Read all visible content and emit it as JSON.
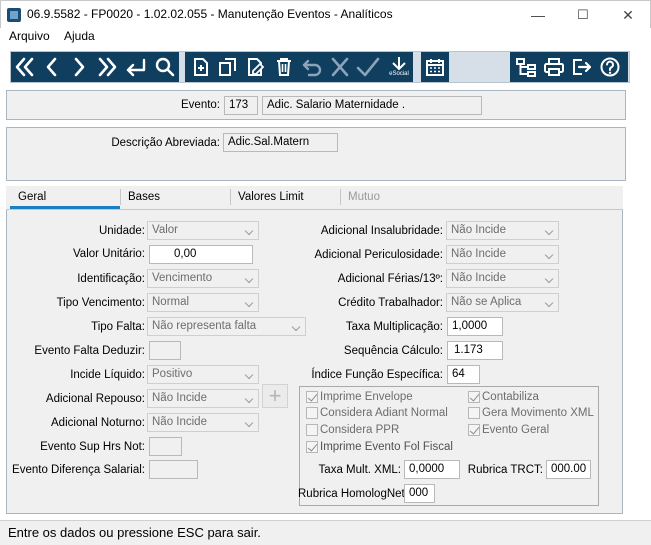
{
  "window": {
    "title": "06.9.5582 - FP0020 - 1.02.02.055 - Manutenção Eventos - Analíticos",
    "minimize": "—",
    "maximize": "☐",
    "close": "✕"
  },
  "menu": {
    "items": [
      "Arquivo",
      "Ajuda"
    ]
  },
  "toolbar": {
    "buttons": [
      "first-icon",
      "previous-icon",
      "next-icon",
      "last-icon",
      "enter-icon",
      "search-icon",
      "new-document-icon",
      "copy-icon",
      "edit-icon",
      "delete-icon",
      "undo-icon",
      "cancel-icon",
      "confirm-icon",
      "esocial-icon",
      "calendar-icon",
      "hierarchy-icon",
      "print-icon",
      "exit-icon",
      "help-icon"
    ],
    "esocial_label": "eSocial"
  },
  "header": {
    "evento_label": "Evento:",
    "evento_code": "173",
    "evento_name": "Adic. Salario Maternidade  .",
    "descricao_label": "Descrição Abreviada:",
    "descricao_value": "Adic.Sal.Matern"
  },
  "tabs": [
    {
      "label": "Geral",
      "state": "active"
    },
    {
      "label": "Bases",
      "state": "normal"
    },
    {
      "label": "Valores Limit",
      "state": "normal"
    },
    {
      "label": "Mutuo",
      "state": "disabled"
    }
  ],
  "geral": {
    "unidade": {
      "label": "Unidade:",
      "value": "Valor"
    },
    "valor_unitario": {
      "label": "Valor Unitário:",
      "value": "0,00"
    },
    "identificacao": {
      "label": "Identificação:",
      "value": "Vencimento"
    },
    "tipo_vencimento": {
      "label": "Tipo Vencimento:",
      "value": "Normal"
    },
    "tipo_falta": {
      "label": "Tipo Falta:",
      "value": "Não representa falta"
    },
    "evento_falta_deduzir": {
      "label": "Evento Falta Deduzir:",
      "value": ""
    },
    "incide_liquido": {
      "label": "Incide Líquido:",
      "value": "Positivo"
    },
    "adicional_repouso": {
      "label": "Adicional Repouso:",
      "value": "Não Incide"
    },
    "adicional_noturno": {
      "label": "Adicional Noturno:",
      "value": "Não Incide"
    },
    "evento_sup_hrs_not": {
      "label": "Evento Sup Hrs Not:",
      "value": ""
    },
    "evento_diferenca_salarial": {
      "label": "Evento Diferença Salarial:",
      "value": ""
    },
    "adicional_insalubridade": {
      "label": "Adicional Insalubridade:",
      "value": "Não Incide"
    },
    "adicional_periculosidade": {
      "label": "Adicional Periculosidade:",
      "value": "Não Incide"
    },
    "adicional_ferias": {
      "label": "Adicional Férias/13º:",
      "value": "Não Incide"
    },
    "credito_trabalhador": {
      "label": "Crédito Trabalhador:",
      "value": "Não se Aplica"
    },
    "taxa_multiplicacao": {
      "label": "Taxa Multiplicação:",
      "value": "1,0000"
    },
    "sequencia_calculo": {
      "label": "Sequência Cálculo:",
      "value": "1.173"
    },
    "indice_funcao": {
      "label": "Índice Função Específica:",
      "value": "64"
    },
    "add_button": "+"
  },
  "options": {
    "imprime_envelope": {
      "label": "Imprime Envelope",
      "checked": true
    },
    "considera_adiant_normal": {
      "label": "Considera Adiant Normal",
      "checked": false
    },
    "considera_ppr": {
      "label": "Considera PPR",
      "checked": false
    },
    "imprime_evento_fol_fiscal": {
      "label": "Imprime Evento Fol Fiscal",
      "checked": true
    },
    "contabiliza": {
      "label": "Contabiliza",
      "checked": true
    },
    "gera_movimento_xml": {
      "label": "Gera Movimento XML",
      "checked": false
    },
    "evento_geral": {
      "label": "Evento Geral",
      "checked": true
    },
    "taxa_mult_xml": {
      "label": "Taxa Mult. XML:",
      "value": "0,0000"
    },
    "rubrica_trct": {
      "label": "Rubrica TRCT:",
      "value": "000.00"
    },
    "rubrica_homolognet": {
      "label": "Rubrica HomologNet:",
      "value": "000"
    }
  },
  "status": {
    "text": "Entre os dados ou pressione ESC para sair."
  },
  "colors": {
    "toolbar_button": "#0f3e5f",
    "toolbar_bg": "#d6dfe7",
    "active_tab_underline": "#1a7fc4"
  }
}
